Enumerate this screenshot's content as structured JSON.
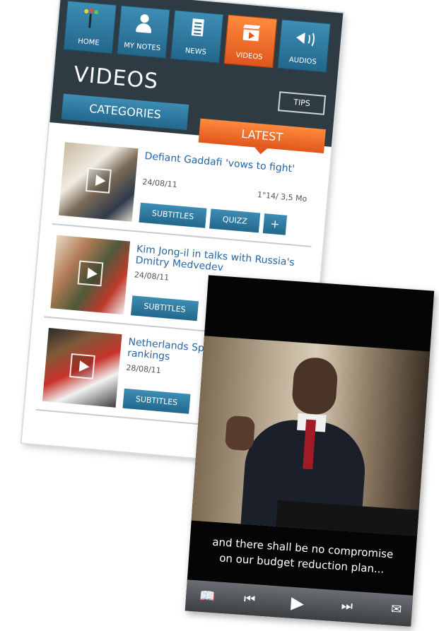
{
  "nav": {
    "home": "HOME",
    "notes": "MY NOTES",
    "news": "NEWS",
    "videos": "VIDEOS",
    "audios": "AUDIOS"
  },
  "page": {
    "title": "VIDEOS",
    "tips": "TIPS"
  },
  "tabs": {
    "categories": "CATEGORIES",
    "latest": "LATEST"
  },
  "items": [
    {
      "title": "Defiant Gaddafi 'vows to fight'",
      "date": "24/08/11",
      "meta": "1\"14/ 3,5 Mo",
      "subtitles": "SUBTITLES",
      "quizz": "QUIZZ",
      "plus": "+"
    },
    {
      "title": "Kim Jong-il in talks with Russia's Dmitry Medvedev",
      "date": "24/08/11",
      "subtitles": "SUBTITLES"
    },
    {
      "title": "Netherlands Spain to top rankings",
      "date": "28/08/11",
      "subtitles": "SUBTITLES"
    }
  ],
  "player": {
    "subtitle_line1": "and there shall be no compromise",
    "subtitle_line2": "on our budget reduction plan...",
    "icons": [
      "book-icon",
      "rewind-icon",
      "play-icon",
      "skip-forward-icon",
      "message-icon"
    ]
  },
  "colors": {
    "accent_blue": "#2f7ea7",
    "accent_orange": "#ee6a2a",
    "dark": "#2f3b43"
  }
}
